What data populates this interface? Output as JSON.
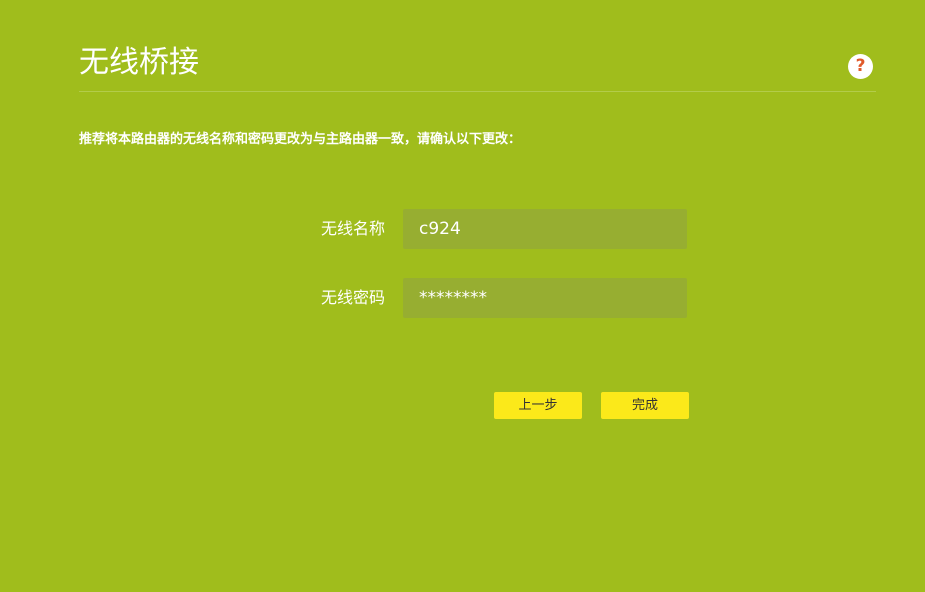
{
  "header": {
    "title": "无线桥接",
    "help_icon": "help-circle-icon",
    "help_glyph": "?"
  },
  "instruction": "推荐将本路由器的无线名称和密码更改为与主路由器一致，请确认以下更改：",
  "form": {
    "ssid_label": "无线名称",
    "ssid_value": "c924",
    "password_label": "无线密码",
    "password_value": "********"
  },
  "buttons": {
    "prev_label": "上一步",
    "finish_label": "完成"
  },
  "colors": {
    "background": "#a0bd1c",
    "input_background": "#97ae31",
    "button_background": "#fbe91a",
    "help_icon_color": "#e05a2b"
  }
}
